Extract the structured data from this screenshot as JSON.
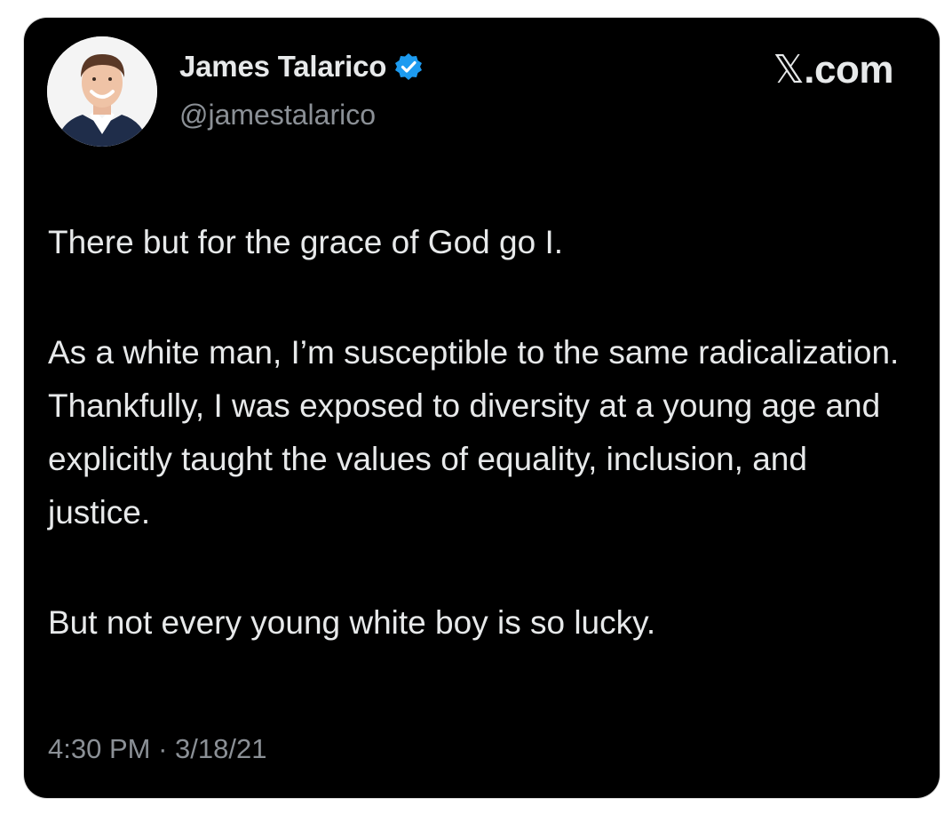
{
  "tweet": {
    "author_name": "James Talarico",
    "author_handle": "@jamestalarico",
    "verified": true,
    "brand": {
      "mark": "𝕏",
      "domain": ".com"
    },
    "paragraphs": [
      "There but for the grace of God go I.",
      "As a white man, I’m susceptible to the same radicalization. Thankfully, I was exposed to diversity at a young age and explicitly taught the values of equality, inclusion, and justice.",
      "But not every young white boy is so lucky."
    ],
    "time": "4:30 PM",
    "separator": "·",
    "date": "3/18/21"
  },
  "colors": {
    "background": "#000000",
    "text": "#e7e9ea",
    "secondary_text": "#8b9096",
    "verified_badge": "#1d9bf0"
  },
  "icons": {
    "avatar": "profile-photo",
    "badge": "verified-badge-icon"
  }
}
